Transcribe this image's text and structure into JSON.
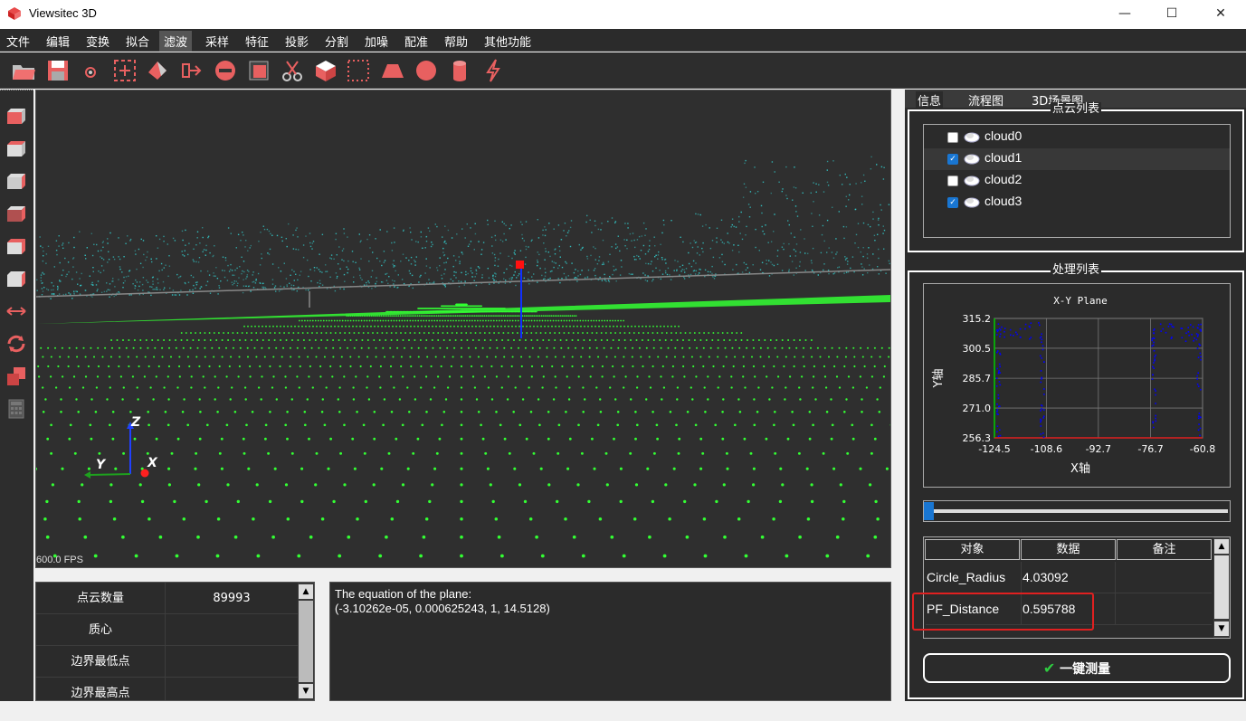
{
  "window": {
    "title": "Viewsitec 3D",
    "minimize": "—",
    "maximize": "☐",
    "close": "✕"
  },
  "menu": [
    "文件",
    "编辑",
    "变换",
    "拟合",
    "滤波",
    "采样",
    "特征",
    "投影",
    "分割",
    "加噪",
    "配准",
    "帮助",
    "其他功能"
  ],
  "menu_active": "滤波",
  "toolbar_icons": [
    "open-folder-icon",
    "save-icon",
    "point-icon",
    "add-box-icon",
    "paint-icon",
    "export-icon",
    "remove-icon",
    "frame-icon",
    "scissors-icon",
    "cube-icon",
    "selection-rect-icon",
    "trapezoid-icon",
    "sphere-icon",
    "cylinder-icon",
    "lightning-icon"
  ],
  "left_toolbar_icons": [
    "view-front-icon",
    "view-back-icon",
    "view-left-icon",
    "view-right-icon",
    "view-top-icon",
    "view-bottom-icon",
    "resize-arrows-icon",
    "rotate-icon",
    "layers-icon",
    "calculator-icon"
  ],
  "viewport": {
    "fps": "600.0 FPS",
    "axis_z": "Z",
    "axis_y": "Y",
    "axis_x": "X"
  },
  "properties": {
    "rows": [
      {
        "key": "点云数量",
        "value": "89993"
      },
      {
        "key": "质心",
        "value": ""
      },
      {
        "key": "边界最低点",
        "value": ""
      },
      {
        "key": "边界最高点",
        "value": ""
      }
    ]
  },
  "console": {
    "line1": "The equation of the plane:",
    "line2": "(-3.10262e-05, 0.000625243, 1, 14.5128)"
  },
  "right_tabs": [
    "信息",
    "流程图",
    "3D场景图"
  ],
  "cloud_list": {
    "title": "点云列表",
    "items": [
      {
        "name": "cloud0",
        "checked": false
      },
      {
        "name": "cloud1",
        "checked": true
      },
      {
        "name": "cloud2",
        "checked": false
      },
      {
        "name": "cloud3",
        "checked": true
      }
    ]
  },
  "process_list": {
    "title": "处理列表"
  },
  "chart_data": {
    "type": "scatter",
    "title": "X-Y Plane",
    "xlabel": "X轴",
    "ylabel": "Y轴",
    "xlim": [
      -124.5,
      -60.8
    ],
    "ylim": [
      256.3,
      315.2
    ],
    "xticks": [
      "-124.5",
      "-108.6",
      "-92.7",
      "-76.7",
      "-60.8"
    ],
    "yticks": [
      "315.2",
      "300.5",
      "285.7",
      "271.0",
      "256.3"
    ],
    "grid": true,
    "series_color": "#0000ff"
  },
  "slider": {
    "value": 0
  },
  "measure_table": {
    "headers": [
      "对象",
      "数据",
      "备注"
    ],
    "rows": [
      {
        "object": "Circle_Radius",
        "data": "4.03092",
        "note": ""
      },
      {
        "object": "PF_Distance",
        "data": "0.595788",
        "note": ""
      }
    ]
  },
  "measure_button": {
    "label": "一键测量",
    "check": "✔"
  },
  "colors": {
    "accent": "#1976d2",
    "highlight": "#e02020",
    "ground_points": "#33ff33",
    "cloud_points": "#33cccc"
  }
}
